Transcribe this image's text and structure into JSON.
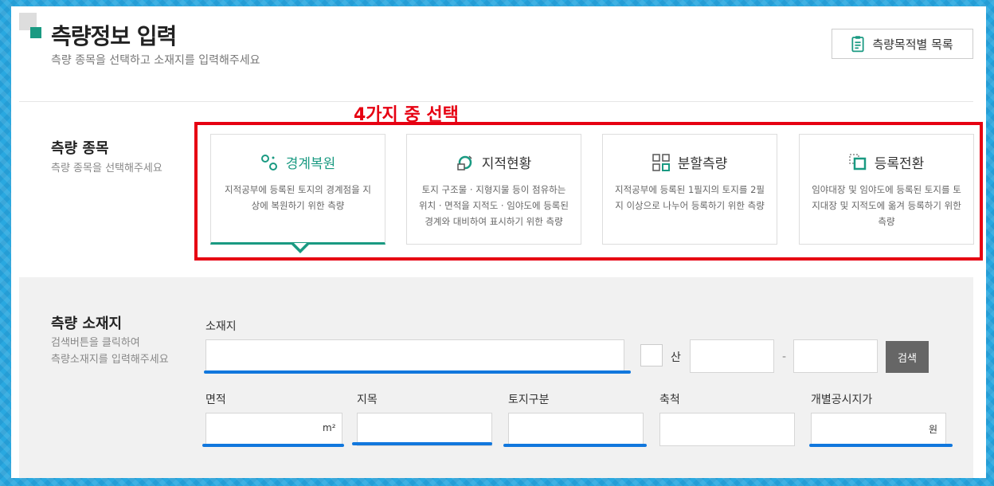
{
  "header": {
    "title": "측량정보 입력",
    "subtitle": "측량 종목을 선택하고 소재지를 입력해주세요",
    "list_button": "측량목적별 목록"
  },
  "annotation": "4가지 중 선택",
  "survey_type": {
    "title": "측량 종목",
    "desc": "측량 종목을 선택해주세요",
    "cards": [
      {
        "label": "경계복원",
        "icon": "boundary-icon",
        "desc": "지적공부에 등록된 토지의 경계점을 지상에 복원하기 위한 측량",
        "selected": true
      },
      {
        "label": "지적현황",
        "icon": "cadastral-status-icon",
        "desc": "토지 구조물 · 지형지물 등이 점유하는 위치 · 면적을 지적도 · 임야도에 등록된 경계와 대비하여 표시하기 위한 측량",
        "selected": false
      },
      {
        "label": "분할측량",
        "icon": "grid-split-icon",
        "desc": "지적공부에 등록된 1필지의 토지를 2필지 이상으로 나누어 등록하기 위한 측량",
        "selected": false
      },
      {
        "label": "등록전환",
        "icon": "register-convert-icon",
        "desc": "임야대장 및 임야도에 등록된 토지를 토지대장 및 지적도에 옮겨 등록하기 위한 측량",
        "selected": false
      }
    ]
  },
  "location": {
    "title": "측량 소재지",
    "desc_line1": "검색버튼을 클릭하여",
    "desc_line2": "측량소재지를 입력해주세요",
    "address_label": "소재지",
    "mountain_label": "산",
    "dash": "-",
    "search_button": "검색",
    "fields": {
      "area_label": "면적",
      "area_unit": "m²",
      "land_category_label": "지목",
      "land_division_label": "토지구분",
      "scale_label": "축척",
      "price_label": "개별공시지가",
      "price_unit": "원"
    }
  },
  "colors": {
    "accent": "#1a9a82",
    "annotation_red": "#e60012",
    "underline_blue": "#1177dd",
    "search_button_bg": "#666666"
  }
}
